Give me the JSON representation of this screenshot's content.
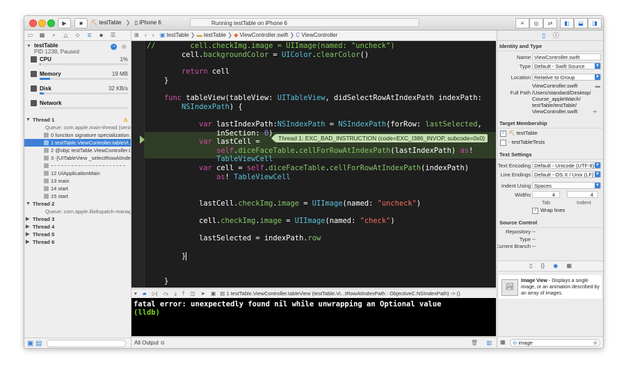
{
  "toolbar": {
    "scheme": "testTable",
    "device": "iPhone 6",
    "status": "Running testTable on iPhone 6"
  },
  "navigator": {
    "process": {
      "name": "testTable",
      "pid": "PID 1238, Paused"
    },
    "gauges": [
      {
        "name": "CPU",
        "value": "1%",
        "level": 0.01
      },
      {
        "name": "Memory",
        "value": "19 MB",
        "level": 0.12
      },
      {
        "name": "Disk",
        "value": "32 KB/s",
        "level": 0.05
      },
      {
        "name": "Network",
        "value": "",
        "level": 0
      }
    ],
    "threads": [
      {
        "text": "Thread 1",
        "kind": "head"
      },
      {
        "text": "Queue: com.apple.main-thread (serial)",
        "kind": "sub"
      },
      {
        "text": "0 function signature specialization...",
        "kind": "frame"
      },
      {
        "text": "1 testTable.ViewController.tableVi...",
        "kind": "sel"
      },
      {
        "text": "2 @objc testTable.ViewController.t...",
        "kind": "frame"
      },
      {
        "text": "3 -[UITableView _selectRowAtInde...",
        "kind": "frame"
      },
      {
        "text": "",
        "kind": "frame"
      },
      {
        "text": "12 UIApplicationMain",
        "kind": "frame"
      },
      {
        "text": "13 main",
        "kind": "frame"
      },
      {
        "text": "14 start",
        "kind": "frame"
      },
      {
        "text": "15 start",
        "kind": "frame"
      },
      {
        "text": "Thread 2",
        "kind": "head"
      },
      {
        "text": "Queue: com.apple.libdispatch-manager...",
        "kind": "sub"
      },
      {
        "text": "Thread 3",
        "kind": "head"
      },
      {
        "text": "Thread 4",
        "kind": "head"
      },
      {
        "text": "Thread 5",
        "kind": "head"
      },
      {
        "text": "Thread 6",
        "kind": "head"
      }
    ]
  },
  "jumpbar": {
    "items": [
      "testTable",
      "testTable",
      "ViewController.swift",
      "ViewController"
    ]
  },
  "editor": {
    "error_badge": "Thread 1: EXC_BAD_INSTRUCTION (code=EXC_I386_INVOP, subcode=0x0)"
  },
  "debug": {
    "frame": "1 testTable.ViewController.tableView (testTable.Vi...tRowAtIndexPath : ObjectiveC.NSIndexPath) -> ()",
    "console": [
      "fatal error: unexpectedly found nil while unwrapping an Optional value",
      "(lldb)"
    ],
    "output_selector": "All Output ≎"
  },
  "inspector": {
    "identity": {
      "section": "Identity and Type",
      "name_label": "Name",
      "name": "ViewController.swift",
      "type_label": "Type",
      "type": "Default - Swift Source",
      "location_label": "Location",
      "location": "Relative to Group",
      "location_file": "ViewController.swift",
      "fullpath_label": "Full Path",
      "fullpath": [
        "/Users/standard/Desktop/",
        "Course_appleWatch/",
        "testTable/testTable/",
        "ViewController.swift"
      ]
    },
    "target": {
      "section": "Target Membership",
      "items": [
        {
          "label": "testTable",
          "checked": true
        },
        {
          "label": "testTableTests",
          "checked": false
        }
      ]
    },
    "text_settings": {
      "section": "Text Settings",
      "encoding_label": "Text Encoding",
      "encoding": "Default - Unicode (UTF-8)",
      "endings_label": "Line Endings",
      "endings": "Default - OS X / Unix (LF)",
      "indent_label": "Indent Using",
      "indent": "Spaces",
      "widths_label": "Widths",
      "tab_value": "4",
      "indent_value": "4",
      "tab_label": "Tab",
      "indent_col_label": "Indent",
      "wrap_label": "Wrap lines"
    },
    "source_control": {
      "section": "Source Control",
      "repo_label": "Repository",
      "repo": "--",
      "type_label": "Type",
      "type": "--",
      "branch_label": "Current Branch",
      "branch": "--"
    },
    "library_item": {
      "title": "Image View",
      "desc": " - Displays a single image, or an animation described by an array of images."
    },
    "filter": "image"
  }
}
